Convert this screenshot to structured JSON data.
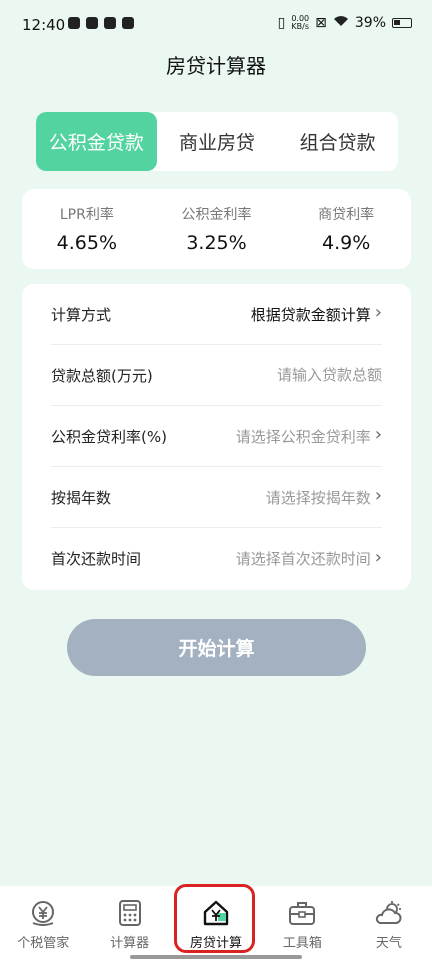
{
  "status_bar": {
    "time": "12:40",
    "net_speed": "0.00",
    "net_unit": "KB/s",
    "battery": "39%"
  },
  "header": {
    "title": "房贷计算器"
  },
  "loan_tabs": [
    {
      "label": "公积金贷款",
      "active": true
    },
    {
      "label": "商业房贷",
      "active": false
    },
    {
      "label": "组合贷款",
      "active": false
    }
  ],
  "rates": [
    {
      "label": "LPR利率",
      "value": "4.65%"
    },
    {
      "label": "公积金利率",
      "value": "3.25%"
    },
    {
      "label": "商贷利率",
      "value": "4.9%"
    }
  ],
  "form": {
    "method": {
      "label": "计算方式",
      "value": "根据贷款金额计算"
    },
    "amount": {
      "label": "贷款总额(万元)",
      "placeholder": "请输入贷款总额"
    },
    "rate": {
      "label": "公积金贷利率(%)",
      "placeholder": "请选择公积金贷利率"
    },
    "years": {
      "label": "按揭年数",
      "placeholder": "请选择按揭年数"
    },
    "first_payment": {
      "label": "首次还款时间",
      "placeholder": "请选择首次还款时间"
    }
  },
  "start_button": "开始计算",
  "bottom_nav": [
    {
      "label": "个税管家",
      "icon": "yen-coin-icon"
    },
    {
      "label": "计算器",
      "icon": "calculator-icon"
    },
    {
      "label": "房贷计算",
      "icon": "house-yen-icon",
      "active": true
    },
    {
      "label": "工具箱",
      "icon": "toolbox-icon"
    },
    {
      "label": "天气",
      "icon": "weather-icon"
    }
  ],
  "colors": {
    "accent": "#52d3a0",
    "background": "#eaf8f1",
    "button_disabled": "#a3b1c0",
    "highlight": "#d92222"
  }
}
